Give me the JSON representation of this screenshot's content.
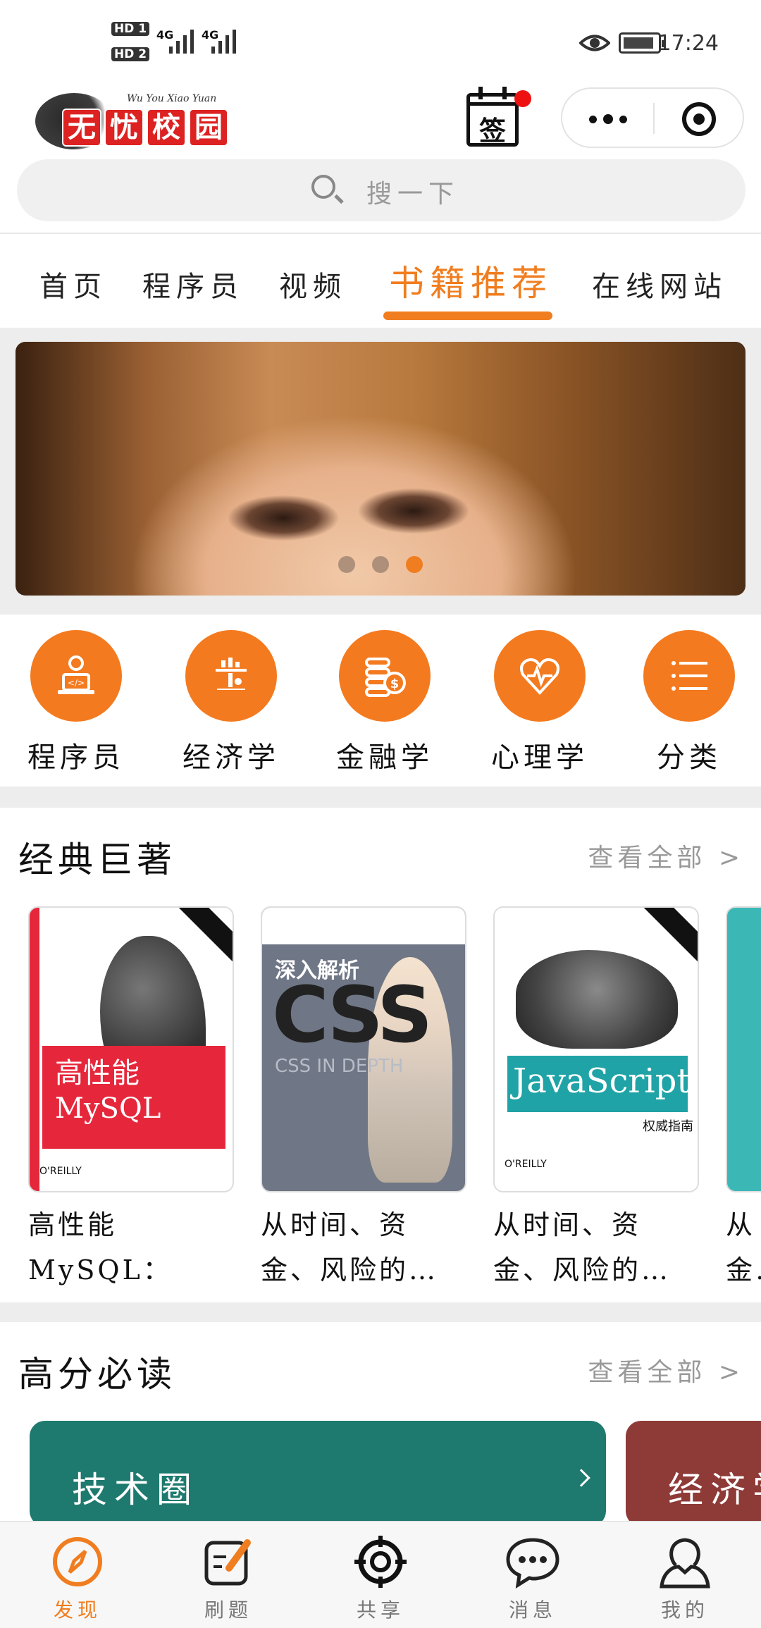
{
  "status": {
    "sim1": "HD 1",
    "sim2": "HD 2",
    "net1": "4G",
    "net2": "4G",
    "time": "17:24"
  },
  "header": {
    "logo_text": [
      "无",
      "忧",
      "校",
      "园"
    ],
    "logo_subtitle": "Wu You Xiao Yuan",
    "signin_label": "签",
    "search_placeholder": "搜一下"
  },
  "tabs": [
    {
      "label": "首页",
      "active": false
    },
    {
      "label": "程序员",
      "active": false
    },
    {
      "label": "视频",
      "active": false
    },
    {
      "label": "书籍推荐",
      "active": true
    },
    {
      "label": "在线网站",
      "active": false
    }
  ],
  "banner": {
    "slide_count": 3,
    "active_slide": 3
  },
  "categories": [
    {
      "label": "程序员",
      "icon": "programmer-icon"
    },
    {
      "label": "经济学",
      "icon": "economics-icon"
    },
    {
      "label": "金融学",
      "icon": "finance-icon"
    },
    {
      "label": "心理学",
      "icon": "psychology-icon"
    },
    {
      "label": "分类",
      "icon": "list-icon"
    }
  ],
  "classic": {
    "title": "经典巨著",
    "more": "查看全部 >",
    "books": [
      {
        "title": "高性能MySQL：第…",
        "cover_cn": "高性能",
        "cover_en": "MySQL",
        "publisher": "O'REILLY"
      },
      {
        "title": "从时间、资金、风险的…",
        "cover_cn": "深入解析",
        "cover_en": "CSS",
        "cover_sub": "CSS IN DEPTH"
      },
      {
        "title": "从时间、资金、风险的…",
        "cover_en": "JavaScript",
        "cover_sub": "权威指南",
        "publisher": "O'REILLY"
      },
      {
        "title": "从金…"
      }
    ]
  },
  "must_read": {
    "title": "高分必读",
    "more": "查看全部 >",
    "cards": [
      {
        "label": "技术圈",
        "color": "#1e7a6e"
      },
      {
        "label": "经济学",
        "color": "#8e3a37"
      }
    ]
  },
  "bottom_nav": [
    {
      "label": "发现",
      "active": true
    },
    {
      "label": "刷题",
      "active": false
    },
    {
      "label": "共享",
      "active": false
    },
    {
      "label": "消息",
      "active": false
    },
    {
      "label": "我的",
      "active": false
    }
  ],
  "colors": {
    "accent": "#f07d1f",
    "badge": "#e11111"
  }
}
